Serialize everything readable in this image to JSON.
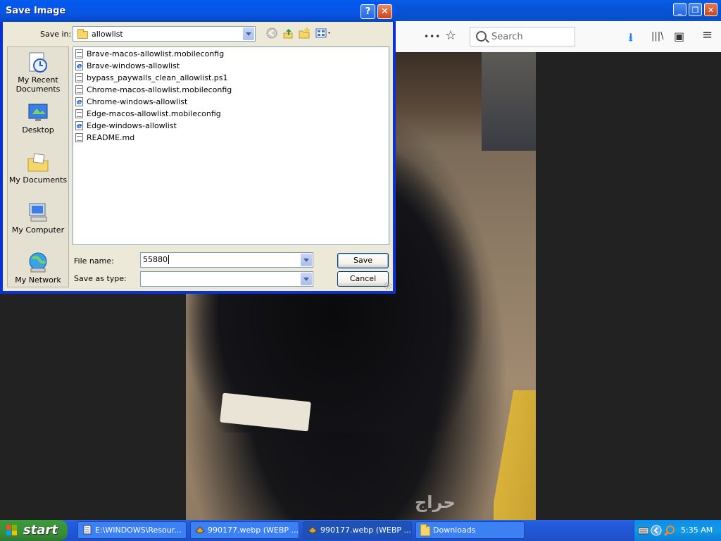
{
  "dialog": {
    "title": "Save Image",
    "help_glyph": "?",
    "close_glyph": "✕",
    "save_in_label": "Save in:",
    "save_in_value": "allowlist",
    "places": [
      {
        "label": "My Recent Documents"
      },
      {
        "label": "Desktop"
      },
      {
        "label": "My Documents"
      },
      {
        "label": "My Computer"
      },
      {
        "label": "My Network"
      }
    ],
    "files": [
      {
        "name": "Brave-macos-allowlist.mobileconfig",
        "icon": "config-file-icon"
      },
      {
        "name": "Brave-windows-allowlist",
        "icon": "ie-file-icon"
      },
      {
        "name": "bypass_paywalls_clean_allowlist.ps1",
        "icon": "config-file-icon"
      },
      {
        "name": "Chrome-macos-allowlist.mobileconfig",
        "icon": "config-file-icon"
      },
      {
        "name": "Chrome-windows-allowlist",
        "icon": "ie-file-icon"
      },
      {
        "name": "Edge-macos-allowlist.mobileconfig",
        "icon": "config-file-icon"
      },
      {
        "name": "Edge-windows-allowlist",
        "icon": "ie-file-icon"
      },
      {
        "name": "README.md",
        "icon": "config-file-icon"
      }
    ],
    "file_name_label": "File name:",
    "file_name_value": "55880",
    "save_as_type_label": "Save as type:",
    "save_as_type_value": "",
    "save_button": "Save",
    "cancel_button": "Cancel"
  },
  "browser": {
    "search_placeholder": "Search",
    "overflow_glyph": "•••",
    "bookmark_glyph": "☆",
    "download_glyph": "⭳",
    "library_glyph": "|||\\",
    "sidebar_glyph": "▣",
    "menu_glyph": "≡",
    "minimize_glyph": "_",
    "restore_glyph": "❐",
    "close_glyph": "✕"
  },
  "image": {
    "watermark": "حراج"
  },
  "taskbar": {
    "start_label": "start",
    "items": [
      {
        "label": "E:\\WINDOWS\\Resour..."
      },
      {
        "label": "990177.webp (WEBP ..."
      },
      {
        "label": "990177.webp (WEBP ..."
      },
      {
        "label": "Downloads"
      }
    ],
    "clock": "5:35 AM"
  },
  "colors": {
    "xp_blue": "#0a55e4",
    "dialog_bg": "#ece9d8",
    "start_green": "#3a8e3a"
  }
}
